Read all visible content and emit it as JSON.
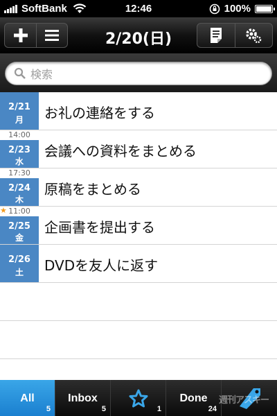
{
  "statusbar": {
    "carrier": "SoftBank",
    "time": "12:46",
    "battery": "100%"
  },
  "navbar": {
    "title": "2/20(日)"
  },
  "search": {
    "placeholder": "検索"
  },
  "tasks": [
    {
      "time": "",
      "date": "2/21",
      "dow": "月",
      "title": "お礼の連絡をする",
      "starred": false
    },
    {
      "time": "14:00",
      "date": "2/23",
      "dow": "水",
      "title": "会議への資料をまとめる",
      "starred": false
    },
    {
      "time": "17:30",
      "date": "2/24",
      "dow": "木",
      "title": "原稿をまとめる",
      "starred": false
    },
    {
      "time": "11:00",
      "date": "2/25",
      "dow": "金",
      "title": "企画書を提出する",
      "starred": true
    },
    {
      "time": "",
      "date": "2/26",
      "dow": "土",
      "title": "DVDを友人に返す",
      "starred": false
    }
  ],
  "tabs": [
    {
      "label": "All",
      "count": "5",
      "active": true
    },
    {
      "label": "Inbox",
      "count": "5",
      "active": false
    },
    {
      "label": "",
      "icon": "star-icon",
      "count": "1",
      "active": false
    },
    {
      "label": "Done",
      "count": "24",
      "active": false
    },
    {
      "label": "",
      "icon": "tag-icon",
      "count": "",
      "active": false
    }
  ],
  "watermark": "週刊アスキー",
  "colors": {
    "date_blue": "#4a87c4",
    "tab_active": "#2a95de",
    "star_orange": "#f29b1f"
  }
}
